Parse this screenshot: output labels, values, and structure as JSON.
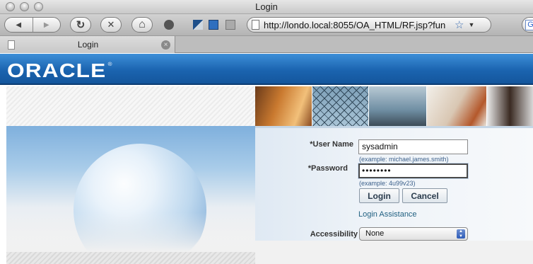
{
  "window": {
    "title": "Login"
  },
  "toolbar": {
    "back_icon": "◀",
    "forward_icon": "▶",
    "reload_icon": "↻",
    "stop_icon": "✕",
    "home_icon": "⌂",
    "url": "http://londo.local:8055/OA_HTML/RF.jsp?fun",
    "bookmark_icon": "☆",
    "dropdown_icon": "▼",
    "search_engine_icon": "G"
  },
  "tab": {
    "label": "Login",
    "close_icon": "×"
  },
  "brand": {
    "logo_text": "ORACLE",
    "logo_mark": "®"
  },
  "login_form": {
    "username_label": "*User Name",
    "username_value": "sysadmin",
    "username_hint": "(example: michael.james.smith)",
    "password_label": "*Password",
    "password_value": "••••••••",
    "password_hint": "(example: 4u99v23)",
    "login_button": "Login",
    "cancel_button": "Cancel",
    "assistance_link": "Login Assistance",
    "accessibility_label": "Accessibility",
    "accessibility_value": "None"
  },
  "colors": {
    "brand_blue": "#1b64b0",
    "hint_text": "#3b5f8a",
    "link": "#1f5f80"
  }
}
